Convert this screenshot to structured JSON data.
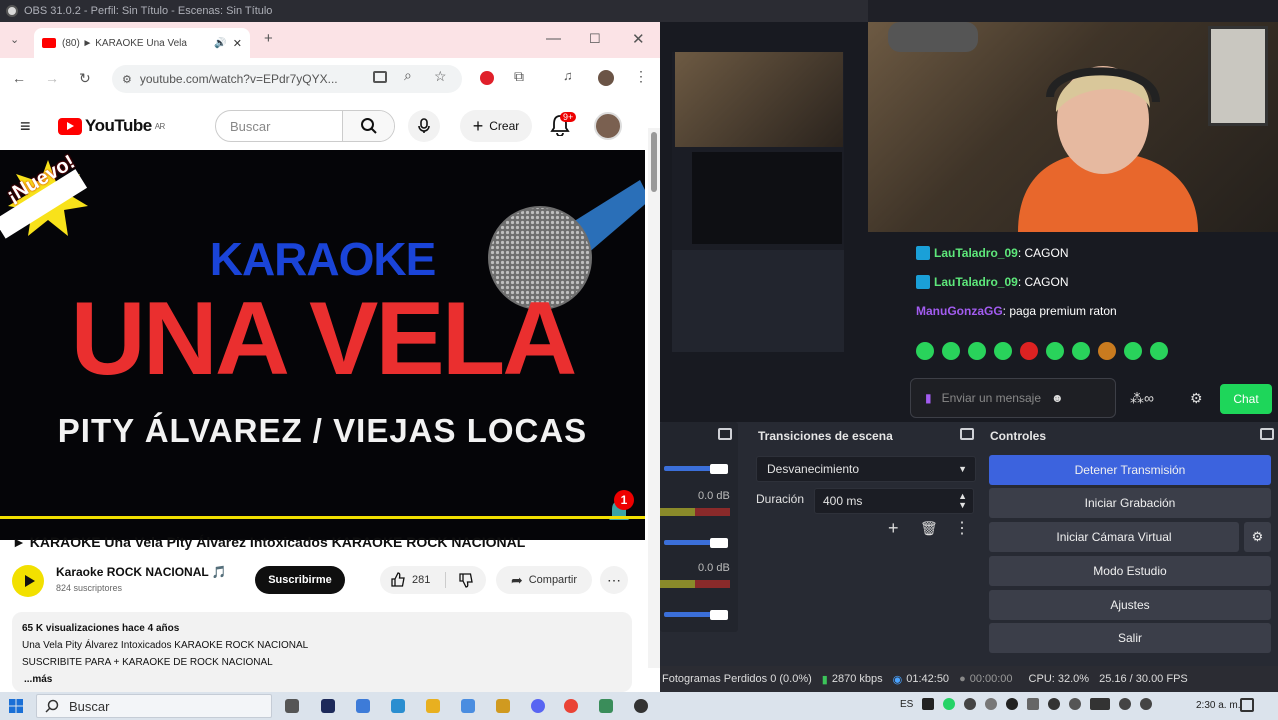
{
  "obs": {
    "title": "OBS 31.0.2 - Perfil: Sin Título - Escenas: Sin Título"
  },
  "browser": {
    "tab_title": "(80) ► KARAOKE Una Vela",
    "url": "youtube.com/watch?v=EPdr7yQYX..."
  },
  "youtube": {
    "logo": "YouTube",
    "country": "AR",
    "search_placeholder": "Buscar",
    "create_label": "Crear",
    "notif_count": "9+",
    "thumbnail": {
      "badge": "¡Nuevo!",
      "line1": "KARAOKE",
      "line2": "UNA VELA",
      "line3": "PITY ÁLVAREZ / VIEJAS LOCAS",
      "bell_count": "1"
    },
    "video_title": "► KARAOKE Una Vela Pity Álvarez Intoxicados KARAOKE ROCK NACIONAL",
    "channel_name": "Karaoke ROCK NACIONAL 🎵",
    "subscribers": "824 suscriptores",
    "subscribe_label": "Suscribirme",
    "likes": "281",
    "share_label": "Compartir",
    "description": {
      "stats": "65 K visualizaciones  hace 4 años",
      "line1": "Una Vela Pity Álvarez Intoxicados KARAOKE ROCK NACIONAL",
      "line2": "SUSCRIBITE PARA + KARAOKE DE ROCK NACIONAL",
      "more": "...más"
    }
  },
  "chat": {
    "messages": [
      {
        "user": "LauTaladro_09",
        "text": ": CAGON"
      },
      {
        "user": "LauTaladro_09",
        "text": ": CAGON"
      },
      {
        "user": "ManuGonzaGG",
        "text": ": paga premium raton"
      }
    ],
    "input_placeholder": "Enviar un mensaje",
    "chat_button": "Chat"
  },
  "docks": {
    "transitions_title": "Transiciones de escena",
    "transition_selected": "Desvanecimiento",
    "duration_label": "Duración",
    "duration_value": "400 ms",
    "controls_title": "Controles",
    "controls": {
      "stop_stream": "Detener Transmisión",
      "start_recording": "Iniciar Grabación",
      "start_virtual_cam": "Iniciar Cámara Virtual",
      "studio_mode": "Modo Estudio",
      "settings": "Ajustes",
      "exit": "Salir"
    },
    "mixer_db1": "0.0 dB",
    "mixer_db2": "0.0 dB"
  },
  "status": {
    "dropped_frames": "Fotogramas Perdidos 0 (0.0%)",
    "bitrate": "2870 kbps",
    "stream_time": "01:42:50",
    "record_time": "00:00:00",
    "cpu": "CPU: 32.0%",
    "fps": "25.16 / 30.00 FPS"
  },
  "taskbar": {
    "search_placeholder": "Buscar",
    "language": "ES",
    "time": "2:30 a. m."
  },
  "colors": {
    "obs_blue": "#3c63de",
    "chat_green": "#1ed65a",
    "yt_red": "#ff0000"
  }
}
